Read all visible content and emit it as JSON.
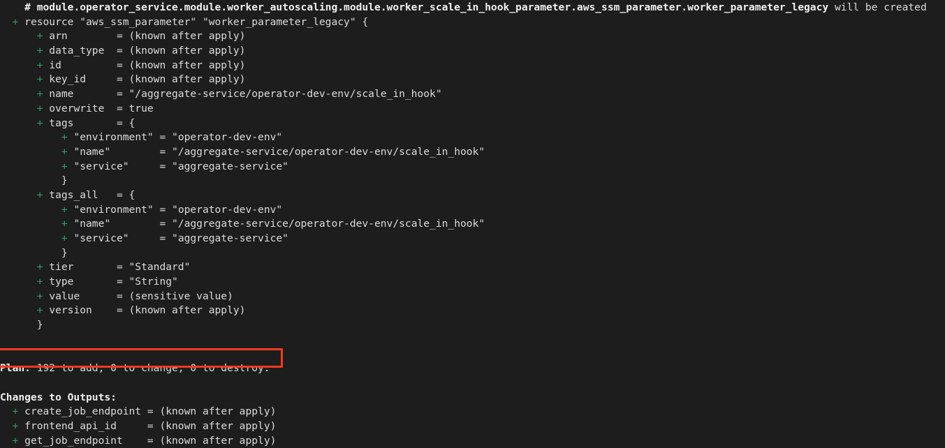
{
  "terminal": {
    "kind": "terraform-plan-output",
    "background_color": "#1d1d1d",
    "text_color": "#dcdcdc",
    "add_marker_color": "#2f9e68",
    "highlight_color": "#ef3b1e",
    "lines": [
      {
        "indent": "  ",
        "marker": "",
        "bold": true,
        "text": "# module.operator_service.module.worker_autoscaling.module.worker_scale_in_hook_parameter.aws_ssm_parameter.worker_parameter_legacy",
        "tail": " will be created"
      },
      {
        "indent": "  ",
        "marker": "+",
        "bold": false,
        "text": "resource \"aws_ssm_parameter\" \"worker_parameter_legacy\" {",
        "tail": ""
      },
      {
        "indent": "      ",
        "marker": "+",
        "bold": false,
        "text": "arn        = (known after apply)",
        "tail": ""
      },
      {
        "indent": "      ",
        "marker": "+",
        "bold": false,
        "text": "data_type  = (known after apply)",
        "tail": ""
      },
      {
        "indent": "      ",
        "marker": "+",
        "bold": false,
        "text": "id         = (known after apply)",
        "tail": ""
      },
      {
        "indent": "      ",
        "marker": "+",
        "bold": false,
        "text": "key_id     = (known after apply)",
        "tail": ""
      },
      {
        "indent": "      ",
        "marker": "+",
        "bold": false,
        "text": "name       = \"/aggregate-service/operator-dev-env/scale_in_hook\"",
        "tail": ""
      },
      {
        "indent": "      ",
        "marker": "+",
        "bold": false,
        "text": "overwrite  = true",
        "tail": ""
      },
      {
        "indent": "      ",
        "marker": "+",
        "bold": false,
        "text": "tags       = {",
        "tail": ""
      },
      {
        "indent": "          ",
        "marker": "+",
        "bold": false,
        "text": "\"environment\" = \"operator-dev-env\"",
        "tail": ""
      },
      {
        "indent": "          ",
        "marker": "+",
        "bold": false,
        "text": "\"name\"        = \"/aggregate-service/operator-dev-env/scale_in_hook\"",
        "tail": ""
      },
      {
        "indent": "          ",
        "marker": "+",
        "bold": false,
        "text": "\"service\"     = \"aggregate-service\"",
        "tail": ""
      },
      {
        "indent": "        ",
        "marker": "",
        "bold": false,
        "text": "}",
        "tail": ""
      },
      {
        "indent": "      ",
        "marker": "+",
        "bold": false,
        "text": "tags_all   = {",
        "tail": ""
      },
      {
        "indent": "          ",
        "marker": "+",
        "bold": false,
        "text": "\"environment\" = \"operator-dev-env\"",
        "tail": ""
      },
      {
        "indent": "          ",
        "marker": "+",
        "bold": false,
        "text": "\"name\"        = \"/aggregate-service/operator-dev-env/scale_in_hook\"",
        "tail": ""
      },
      {
        "indent": "          ",
        "marker": "+",
        "bold": false,
        "text": "\"service\"     = \"aggregate-service\"",
        "tail": ""
      },
      {
        "indent": "        ",
        "marker": "",
        "bold": false,
        "text": "}",
        "tail": ""
      },
      {
        "indent": "      ",
        "marker": "+",
        "bold": false,
        "text": "tier       = \"Standard\"",
        "tail": ""
      },
      {
        "indent": "      ",
        "marker": "+",
        "bold": false,
        "text": "type       = \"String\"",
        "tail": ""
      },
      {
        "indent": "      ",
        "marker": "+",
        "bold": false,
        "text": "value      = (sensitive value)",
        "tail": ""
      },
      {
        "indent": "      ",
        "marker": "+",
        "bold": false,
        "text": "version    = (known after apply)",
        "tail": ""
      },
      {
        "indent": "    ",
        "marker": "",
        "bold": false,
        "text": "}",
        "tail": ""
      },
      {
        "indent": "",
        "marker": "",
        "bold": false,
        "text": "",
        "tail": ""
      },
      {
        "indent": "",
        "marker": "",
        "bold": false,
        "text": "",
        "tail": ""
      },
      {
        "indent": "",
        "marker": "",
        "bold": true,
        "text": "Plan:",
        "tail": " 192 to add, 0 to change, 0 to destroy."
      },
      {
        "indent": "",
        "marker": "",
        "bold": false,
        "text": "",
        "tail": ""
      },
      {
        "indent": "",
        "marker": "",
        "bold": true,
        "text": "Changes to Outputs:",
        "tail": ""
      },
      {
        "indent": "  ",
        "marker": "+",
        "bold": false,
        "text": "create_job_endpoint = (known after apply)",
        "tail": ""
      },
      {
        "indent": "  ",
        "marker": "+",
        "bold": false,
        "text": "frontend_api_id     = (known after apply)",
        "tail": ""
      },
      {
        "indent": "  ",
        "marker": "+",
        "bold": false,
        "text": "get_job_endpoint    = (known after apply)",
        "tail": ""
      }
    ],
    "plan_summary": {
      "label": "Plan:",
      "to_add": "192",
      "to_change": "0",
      "to_destroy": "0",
      "full_text": "Plan: 192 to add, 0 to change, 0 to destroy."
    },
    "resource_header": {
      "address": "module.operator_service.module.worker_autoscaling.module.worker_scale_in_hook_parameter.aws_ssm_parameter.worker_parameter_legacy",
      "action": "will be created"
    },
    "resource": {
      "type": "aws_ssm_parameter",
      "name": "worker_parameter_legacy",
      "attributes": [
        {
          "key": "arn",
          "value": "(known after apply)"
        },
        {
          "key": "data_type",
          "value": "(known after apply)"
        },
        {
          "key": "id",
          "value": "(known after apply)"
        },
        {
          "key": "key_id",
          "value": "(known after apply)"
        },
        {
          "key": "name",
          "value": "\"/aggregate-service/operator-dev-env/scale_in_hook\""
        },
        {
          "key": "overwrite",
          "value": "true"
        },
        {
          "key": "tier",
          "value": "\"Standard\""
        },
        {
          "key": "type",
          "value": "\"String\""
        },
        {
          "key": "value",
          "value": "(sensitive value)"
        },
        {
          "key": "version",
          "value": "(known after apply)"
        }
      ],
      "tags": [
        {
          "key": "\"environment\"",
          "value": "\"operator-dev-env\""
        },
        {
          "key": "\"name\"",
          "value": "\"/aggregate-service/operator-dev-env/scale_in_hook\""
        },
        {
          "key": "\"service\"",
          "value": "\"aggregate-service\""
        }
      ],
      "tags_all": [
        {
          "key": "\"environment\"",
          "value": "\"operator-dev-env\""
        },
        {
          "key": "\"name\"",
          "value": "\"/aggregate-service/operator-dev-env/scale_in_hook\""
        },
        {
          "key": "\"service\"",
          "value": "\"aggregate-service\""
        }
      ]
    },
    "outputs": {
      "heading": "Changes to Outputs:",
      "items": [
        {
          "name": "create_job_endpoint",
          "value": "(known after apply)"
        },
        {
          "name": "frontend_api_id",
          "value": "(known after apply)"
        },
        {
          "name": "get_job_endpoint",
          "value": "(known after apply)"
        }
      ]
    }
  }
}
